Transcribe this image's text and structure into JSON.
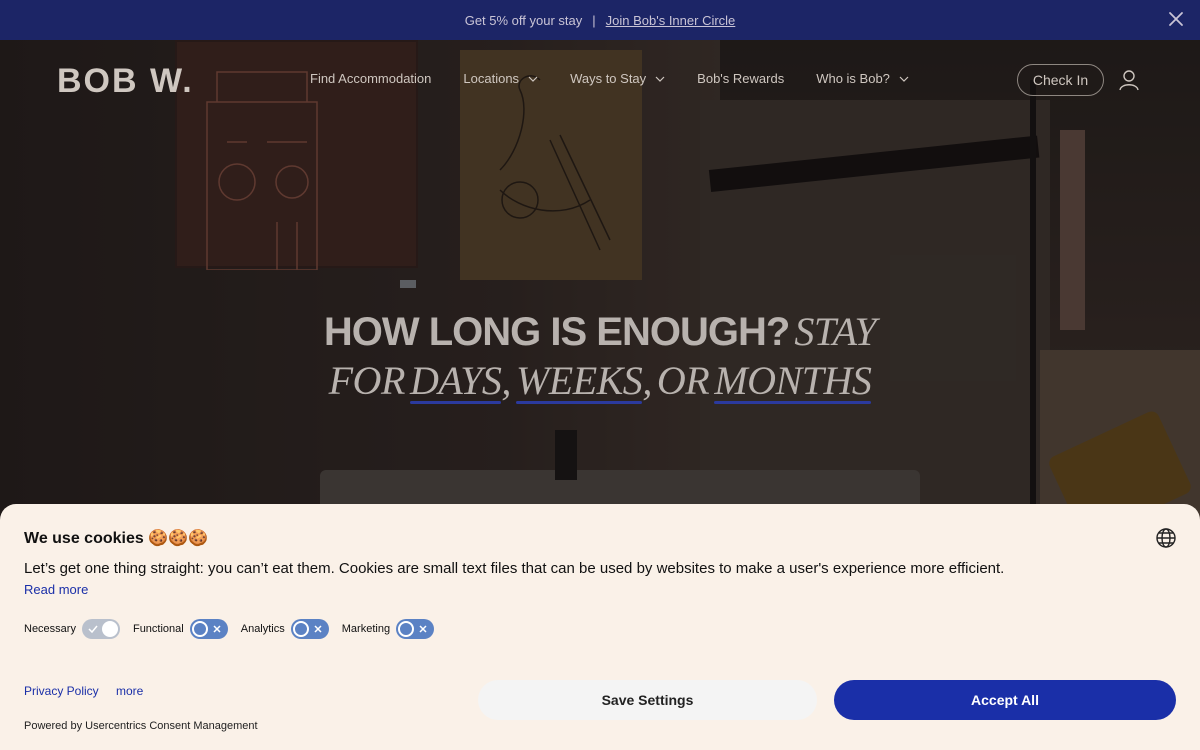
{
  "promo": {
    "offer_text": "Get 5% off your stay",
    "separator": "|",
    "link_text": "Join Bob's Inner Circle"
  },
  "nav": {
    "logo": "BOB W.",
    "items": [
      {
        "label": "Find Accommodation",
        "has_dropdown": false
      },
      {
        "label": "Locations",
        "has_dropdown": true
      },
      {
        "label": "Ways to Stay",
        "has_dropdown": true
      },
      {
        "label": "Bob's Rewards",
        "has_dropdown": false
      },
      {
        "label": "Who is Bob?",
        "has_dropdown": true
      }
    ],
    "checkin_label": "Check In"
  },
  "hero": {
    "headline_bold": "HOW LONG IS ENOUGH?",
    "headline_italic_1": "STAY",
    "headline_italic_2": "FOR",
    "word_days": "DAYS",
    "word_weeks": "WEEKS",
    "word_months": "MONTHS",
    "comma": ",",
    "or": "OR"
  },
  "cookie": {
    "title": "We use cookies 🍪🍪🍪",
    "description": "Let’s get one thing straight: you can’t eat them. Cookies are small text files that can be used by websites to make a user's experience more efficient.",
    "read_more": "Read more",
    "toggles": [
      {
        "label": "Necessary",
        "state": "on-disabled"
      },
      {
        "label": "Functional",
        "state": "off"
      },
      {
        "label": "Analytics",
        "state": "off"
      },
      {
        "label": "Marketing",
        "state": "off"
      }
    ],
    "privacy_policy": "Privacy Policy",
    "more": "more",
    "powered_by": "Powered by Usercentrics Consent Management",
    "save_settings": "Save Settings",
    "accept_all": "Accept All"
  },
  "colors": {
    "promo_bg": "#1c2566",
    "accent_blue": "#1a2fa8",
    "panel_bg": "#faf1e8",
    "underline_blue": "#2b3a9e"
  }
}
